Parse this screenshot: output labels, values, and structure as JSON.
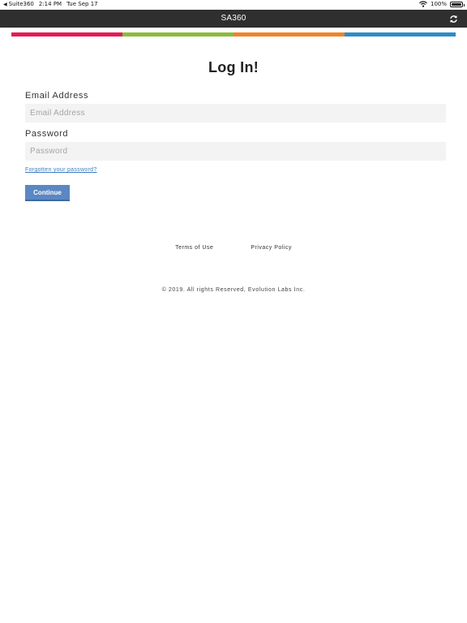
{
  "status_bar": {
    "back_app": "Suite360",
    "time": "2:14 PM",
    "date": "Tue Sep 17",
    "battery": "100%"
  },
  "nav": {
    "title": "SA360",
    "refresh_icon": "refresh-icon"
  },
  "stripe_colors": [
    "#e31c55",
    "#8cbb3a",
    "#ee8429",
    "#2c8cc8"
  ],
  "login": {
    "title": "Log In!",
    "email_label": "Email Address",
    "email_placeholder": "Email Address",
    "email_value": "",
    "password_label": "Password",
    "password_placeholder": "Password",
    "password_value": "",
    "forgot_link": "Forgotten your password?",
    "continue_label": "Continue"
  },
  "footer": {
    "terms": "Terms of Use",
    "privacy": "Privacy Policy",
    "copyright": "© 2019. All rights Reserved, Evolution Labs Inc."
  }
}
